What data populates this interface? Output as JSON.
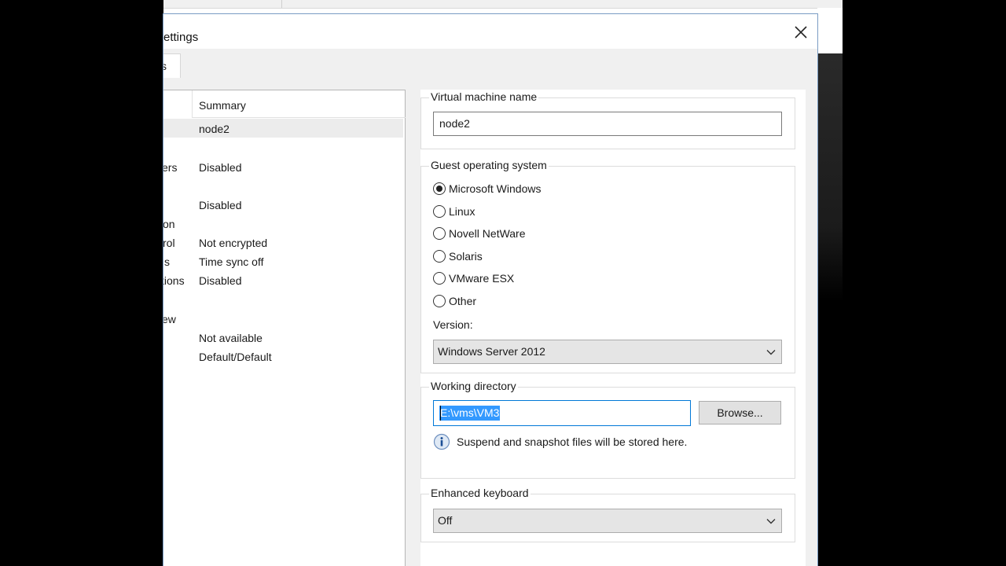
{
  "dialog": {
    "title_partial": "ettings",
    "tab_partial": "s"
  },
  "summary_list": {
    "header": "Summary",
    "rows": [
      {
        "key": "",
        "value": "node2"
      },
      {
        "key": "ers",
        "value": "Disabled"
      },
      {
        "key": "",
        "value": "Disabled"
      },
      {
        "key": "on",
        "value": ""
      },
      {
        "key": "rol",
        "value": "Not encrypted"
      },
      {
        "key": "s",
        "value": "Time sync off"
      },
      {
        "key": "tions",
        "value": "Disabled"
      },
      {
        "key": "ew",
        "value": ""
      },
      {
        "key": "",
        "value": "Not available"
      },
      {
        "key": "",
        "value": "Default/Default"
      }
    ]
  },
  "vm_name": {
    "label": "Virtual machine name",
    "value": "node2"
  },
  "guest_os": {
    "label": "Guest operating system",
    "options": [
      "Microsoft Windows",
      "Linux",
      "Novell NetWare",
      "Solaris",
      "VMware ESX",
      "Other"
    ],
    "selected": "Microsoft Windows",
    "version_label": "Version:",
    "version_value": "Windows Server 2012"
  },
  "working_directory": {
    "label": "Working directory",
    "value": "E:\\vms\\VM3",
    "browse_label": "Browse...",
    "info_text": "Suspend and snapshot files will be stored here."
  },
  "enhanced_keyboard": {
    "label": "Enhanced keyboard",
    "value": "Off"
  },
  "icons": {
    "close": "close-icon",
    "dropdown": "chevron-down-icon",
    "info": "info-icon"
  },
  "colors": {
    "selection": "#3399ff",
    "focus_border": "#0078d7"
  }
}
